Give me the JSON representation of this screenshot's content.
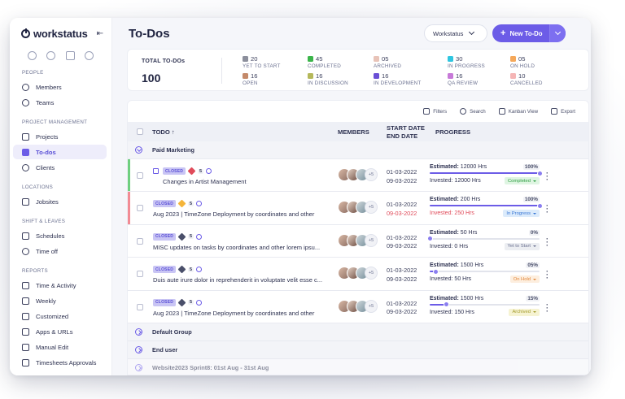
{
  "app": {
    "name": "workstatus",
    "collapse_icon": "collapse-sidebar-icon"
  },
  "colors": {
    "accent": "#6c5ce7",
    "overdue": "#e04b5a",
    "completed_stripe": "#6fcf7f",
    "red_stripe": "#f28b94"
  },
  "sidebar": {
    "sections": [
      {
        "heading": "PEOPLE",
        "items": [
          {
            "label": "Members",
            "icon": "person-icon"
          },
          {
            "label": "Teams",
            "icon": "people-icon"
          }
        ]
      },
      {
        "heading": "PROJECT MANAGEMENT",
        "items": [
          {
            "label": "Projects",
            "icon": "folder-icon"
          },
          {
            "label": "To-dos",
            "icon": "checklist-icon",
            "active": true
          },
          {
            "label": "Clients",
            "icon": "star-icon"
          }
        ]
      },
      {
        "heading": "LOCATIONS",
        "items": [
          {
            "label": "Jobsites",
            "icon": "chart-icon"
          }
        ]
      },
      {
        "heading": "SHIFT & LEAVES",
        "items": [
          {
            "label": "Schedules",
            "icon": "calendar-icon"
          },
          {
            "label": "Time off",
            "icon": "clock-icon"
          }
        ]
      },
      {
        "heading": "REPORTS",
        "items": [
          {
            "label": "Time & Activity",
            "icon": "report-icon"
          },
          {
            "label": "Weekly",
            "icon": "report-icon"
          },
          {
            "label": "Customized",
            "icon": "report-icon"
          },
          {
            "label": "Apps & URLs",
            "icon": "report-icon"
          },
          {
            "label": "Manual Edit",
            "icon": "report-icon"
          },
          {
            "label": "Timesheets Approvals",
            "icon": "report-icon"
          }
        ]
      }
    ]
  },
  "header": {
    "title": "To-Dos",
    "workspace_select": "Workstatus",
    "new_button": "New To-Do"
  },
  "summary": {
    "total_label": "TOTAL TO-DOs",
    "total_value": "100",
    "stats": [
      {
        "value": "20",
        "label": "YET TO START",
        "color": "#8c8f9c"
      },
      {
        "value": "45",
        "label": "COMPLETED",
        "color": "#3bb54a"
      },
      {
        "value": "05",
        "label": "ARCHIVED",
        "color": "#e8c3b8"
      },
      {
        "value": "30",
        "label": "IN PROGRESS",
        "color": "#2fc6e0"
      },
      {
        "value": "05",
        "label": "ON HOLD",
        "color": "#f5a85a"
      },
      {
        "value": "16",
        "label": "OPEN",
        "color": "#c48a6a"
      },
      {
        "value": "16",
        "label": "IN DISCUSSION",
        "color": "#b5b85a"
      },
      {
        "value": "16",
        "label": "IN DEVELOPMENT",
        "color": "#6a4fd6"
      },
      {
        "value": "16",
        "label": "QA REVIEW",
        "color": "#c77ad8"
      },
      {
        "value": "10",
        "label": "CANCELLED",
        "color": "#f5b5b5"
      }
    ]
  },
  "toolbar": {
    "filters": "Filters",
    "search": "Search",
    "kanban": "Kanban View",
    "export": "Export"
  },
  "table": {
    "headers": {
      "todo": "TODO ↑",
      "members": "MEMBERS",
      "start": "START DATE",
      "end": "END DATE",
      "progress": "PROGRESS"
    },
    "groups": [
      {
        "name": "Paid Marketing",
        "rows": [
          {
            "badge": "CLOSED",
            "priority_color": "#e04b5a",
            "num": "5",
            "title": "Changes in Artist Management",
            "subtask": true,
            "more": "+5",
            "start": "01-03-2022",
            "end": "09-03-2022",
            "end_overdue": false,
            "estimated": "12000 Hrs",
            "invested": "12000 Hrs",
            "invested_over": false,
            "pct": "100%",
            "progress": 1.0,
            "status": "Completed",
            "status_bg": "#dff5e2",
            "status_fg": "#2e9e43",
            "stripe": "#6fcf7f"
          },
          {
            "badge": "CLOSED",
            "priority_color": "#f5b53a",
            "num": "5",
            "title": "Aug 2023 | TimeZone Deployment by coordinates and other",
            "subtask": false,
            "more": "+5",
            "start": "01-03-2022",
            "end": "09-03-2022",
            "end_overdue": true,
            "estimated": "200 Hrs",
            "invested": "250 Hrs",
            "invested_over": true,
            "pct": "100%",
            "progress": 1.0,
            "status": "In Progress",
            "status_bg": "#dcebfb",
            "status_fg": "#3a78d6",
            "stripe": "#f28b94"
          },
          {
            "badge": "CLOSED",
            "priority_color": "#4a4f6a",
            "num": "5",
            "title": "MISC updates on tasks by coordinates and other lorem ipsu...",
            "subtask": false,
            "more": "+5",
            "start": "01-03-2022",
            "end": "09-03-2022",
            "end_overdue": false,
            "estimated": "50 Hrs",
            "invested": "0 Hrs",
            "invested_over": false,
            "pct": "0%",
            "progress": 0.0,
            "status": "Yet to Start",
            "status_bg": "#eceef2",
            "status_fg": "#6b7190",
            "stripe": ""
          },
          {
            "badge": "CLOSED",
            "priority_color": "#4a4f6a",
            "num": "5",
            "title": "Duis aute irure dolor in reprehenderit in voluptate velit esse c...",
            "subtask": false,
            "more": "+5",
            "start": "01-03-2022",
            "end": "09-03-2022",
            "end_overdue": false,
            "estimated": "1500 Hrs",
            "invested": "50 Hrs",
            "invested_over": false,
            "pct": "05%",
            "progress": 0.05,
            "status": "On Hold",
            "status_bg": "#fdeede",
            "status_fg": "#e2873a",
            "stripe": ""
          },
          {
            "badge": "CLOSED",
            "priority_color": "#4a4f6a",
            "num": "5",
            "title": "Aug 2023 | TimeZone Deployment by coordinates and other",
            "subtask": false,
            "more": "+5",
            "start": "01-03-2022",
            "end": "09-03-2022",
            "end_overdue": false,
            "estimated": "1500 Hrs",
            "invested": "150 Hrs",
            "invested_over": false,
            "pct": "15%",
            "progress": 0.15,
            "status": "Archived",
            "status_bg": "#f6f3d2",
            "status_fg": "#a39a2a",
            "stripe": ""
          }
        ]
      },
      {
        "name": "Default Group",
        "rows": []
      },
      {
        "name": "End user",
        "rows": []
      },
      {
        "name": "Website2023 Sprint8: 01st Aug - 31st Aug",
        "rows": []
      }
    ]
  }
}
